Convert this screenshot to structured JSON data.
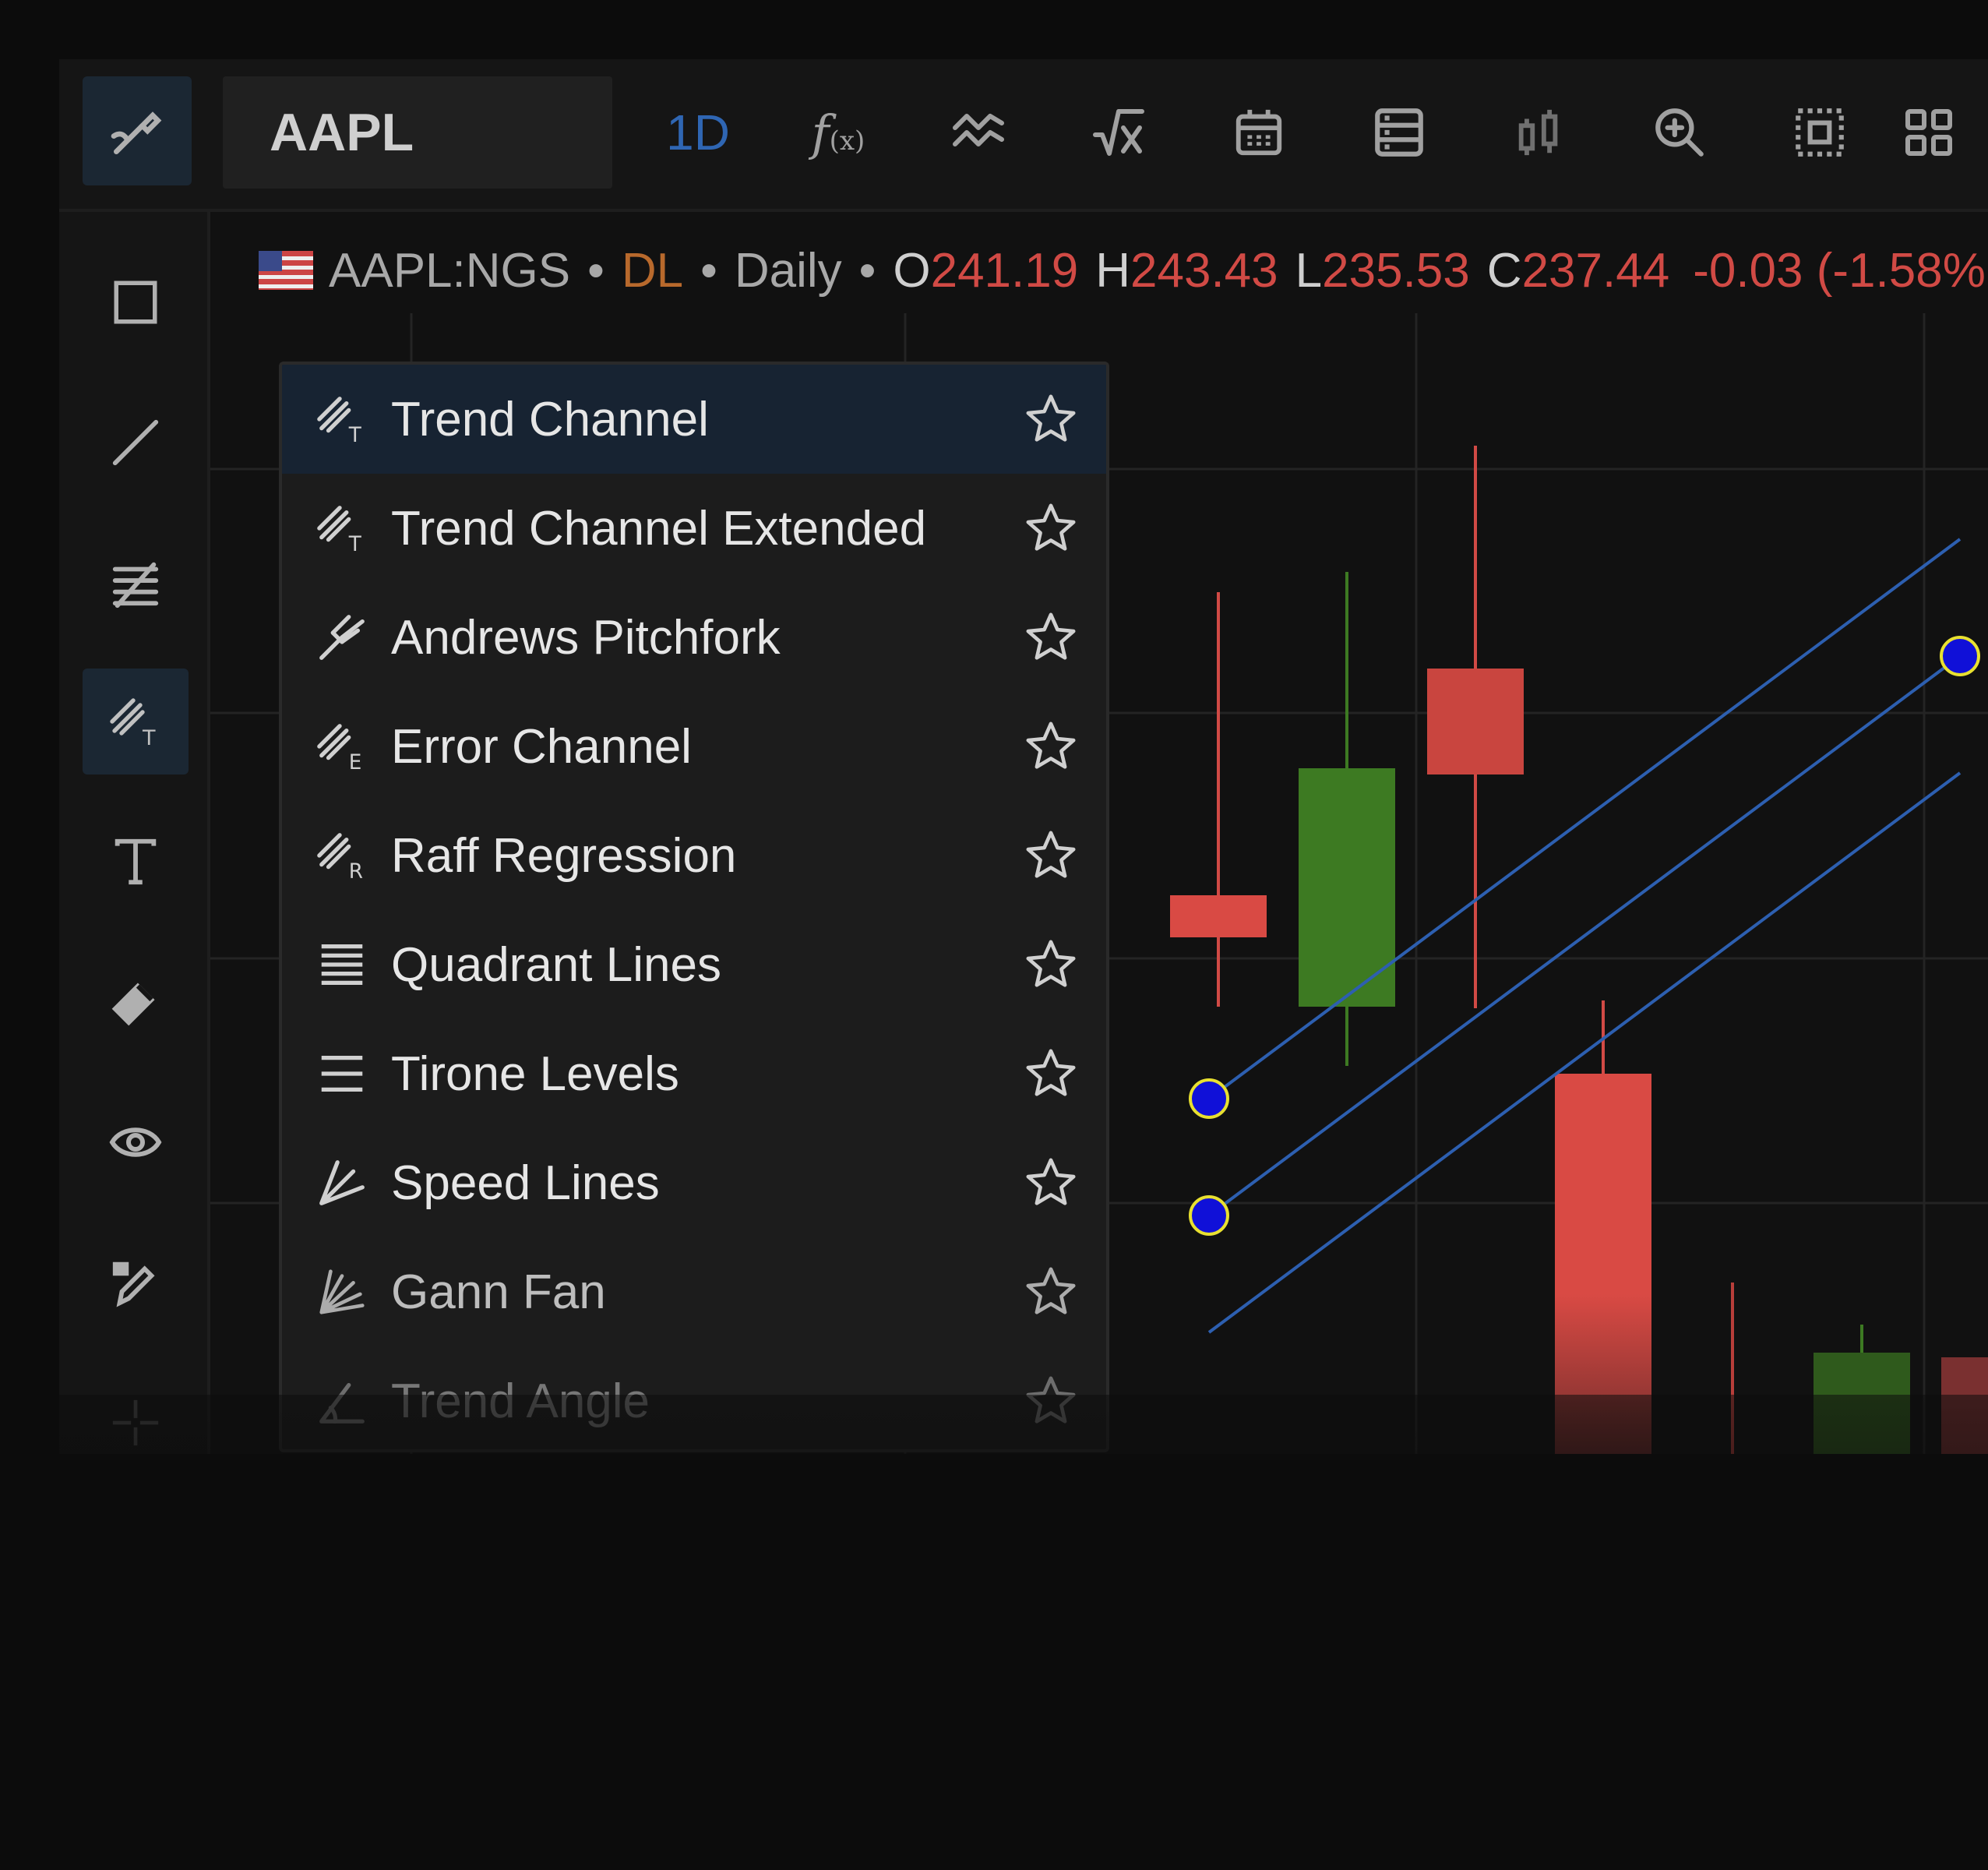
{
  "toolbar": {
    "symbol": "AAPL",
    "interval": "1D",
    "fx_label": "f",
    "fx_sub": "(x)",
    "icons": [
      "draw-tools-icon",
      "function-icon",
      "indicators-icon",
      "sqrt-x-icon",
      "calendar-icon",
      "table-icon",
      "candles-icon",
      "zoom-icon",
      "select-area-icon",
      "layout-grid-icon"
    ]
  },
  "sidebar": {
    "icons": [
      "rectangle-icon",
      "line-icon",
      "fib-icon",
      "trend-channel-icon",
      "text-icon",
      "eraser-icon",
      "eye-icon",
      "lock-pencil-icon",
      "crosshair-icon",
      "magnet-icon"
    ]
  },
  "legend": {
    "symbol": "AAPL:NGS",
    "source": "DL",
    "period": "Daily",
    "open_label": "O",
    "open": "241.19",
    "high_label": "H",
    "high": "243.43",
    "low_label": "L",
    "low": "235.53",
    "close_label": "C",
    "close": "237.44",
    "change": "-0.03 (-1.58%",
    "colors": {
      "value": "#d14a45",
      "source": "#b8692c"
    }
  },
  "menu": {
    "items": [
      {
        "label": "Trend Channel",
        "icon": "trend-channel-icon",
        "active": true
      },
      {
        "label": "Trend Channel Extended",
        "icon": "trend-channel-extended-icon"
      },
      {
        "label": "Andrews Pitchfork",
        "icon": "pitchfork-icon"
      },
      {
        "label": "Error Channel",
        "icon": "error-channel-icon"
      },
      {
        "label": "Raff Regression",
        "icon": "raff-regression-icon"
      },
      {
        "label": "Quadrant Lines",
        "icon": "quadrant-lines-icon"
      },
      {
        "label": "Tirone Levels",
        "icon": "tirone-levels-icon"
      },
      {
        "label": "Speed Lines",
        "icon": "speed-lines-icon"
      },
      {
        "label": "Gann Fan",
        "icon": "gann-fan-icon"
      },
      {
        "label": "Trend Angle",
        "icon": "trend-angle-icon"
      }
    ],
    "sub_letters": [
      "T",
      "T",
      "",
      "E",
      "R",
      "",
      "",
      "",
      "",
      ""
    ]
  },
  "colors": {
    "bull": "#3d7a22",
    "bear": "#d14a45",
    "channel": "#2d5fb0",
    "handle_fill": "#1010d8",
    "handle_stroke": "#e8e030",
    "accent": "#2f66b3"
  }
}
